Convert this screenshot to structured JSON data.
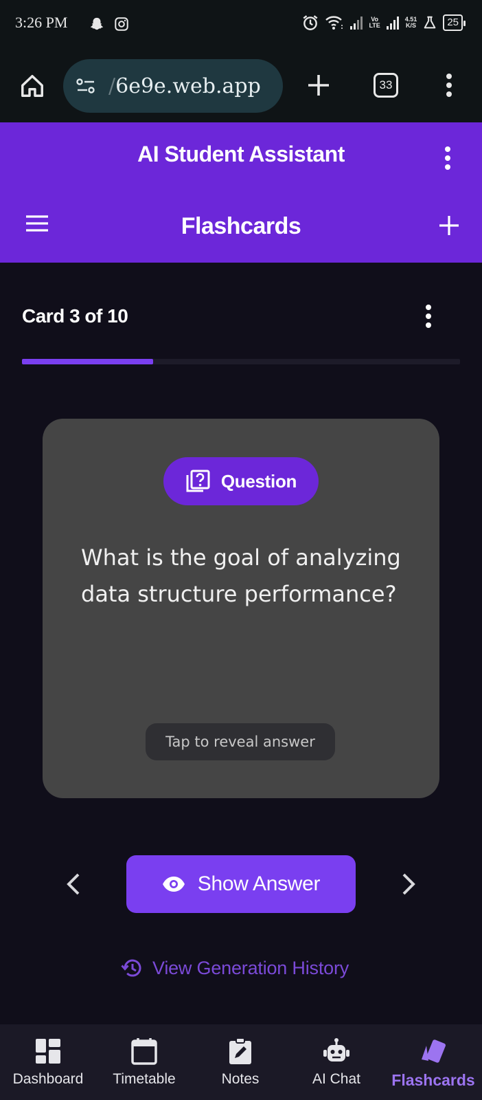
{
  "status_bar": {
    "time": "3:26 PM",
    "network_vo": "Vo",
    "network_lte": "LTE",
    "speed_value": "4.51",
    "speed_unit": "K/S",
    "battery": "25",
    "icons": [
      "snapchat-icon",
      "instagram-icon",
      "alarm-icon",
      "wifi-icon",
      "signal-icon",
      "signal-icon",
      "lab-icon",
      "battery-icon"
    ]
  },
  "browser": {
    "url_faded": "/",
    "url": "6e9e.web.app",
    "tab_count": "33"
  },
  "app_header": {
    "title": "AI Student Assistant",
    "page_title": "Flashcards"
  },
  "deck": {
    "counter": "Card 3 of 10",
    "progress": 0.3
  },
  "card": {
    "chip_label": "Question",
    "question": "What is the goal of analyzing data structure performance?",
    "reveal_hint": "Tap to reveal answer"
  },
  "controls": {
    "show_answer": "Show Answer",
    "history_link": "View Generation History"
  },
  "bottom_nav": {
    "items": [
      {
        "label": "Dashboard",
        "icon": "dashboard-icon"
      },
      {
        "label": "Timetable",
        "icon": "calendar-icon"
      },
      {
        "label": "Notes",
        "icon": "notes-icon"
      },
      {
        "label": "AI Chat",
        "icon": "robot-icon"
      },
      {
        "label": "Flashcards",
        "icon": "cards-icon",
        "active": true
      }
    ]
  },
  "colors": {
    "accent": "#6c27d9",
    "accent_light": "#7a3ff0",
    "active_nav": "#9c74f0",
    "background": "#100e1a",
    "card": "#454545"
  }
}
